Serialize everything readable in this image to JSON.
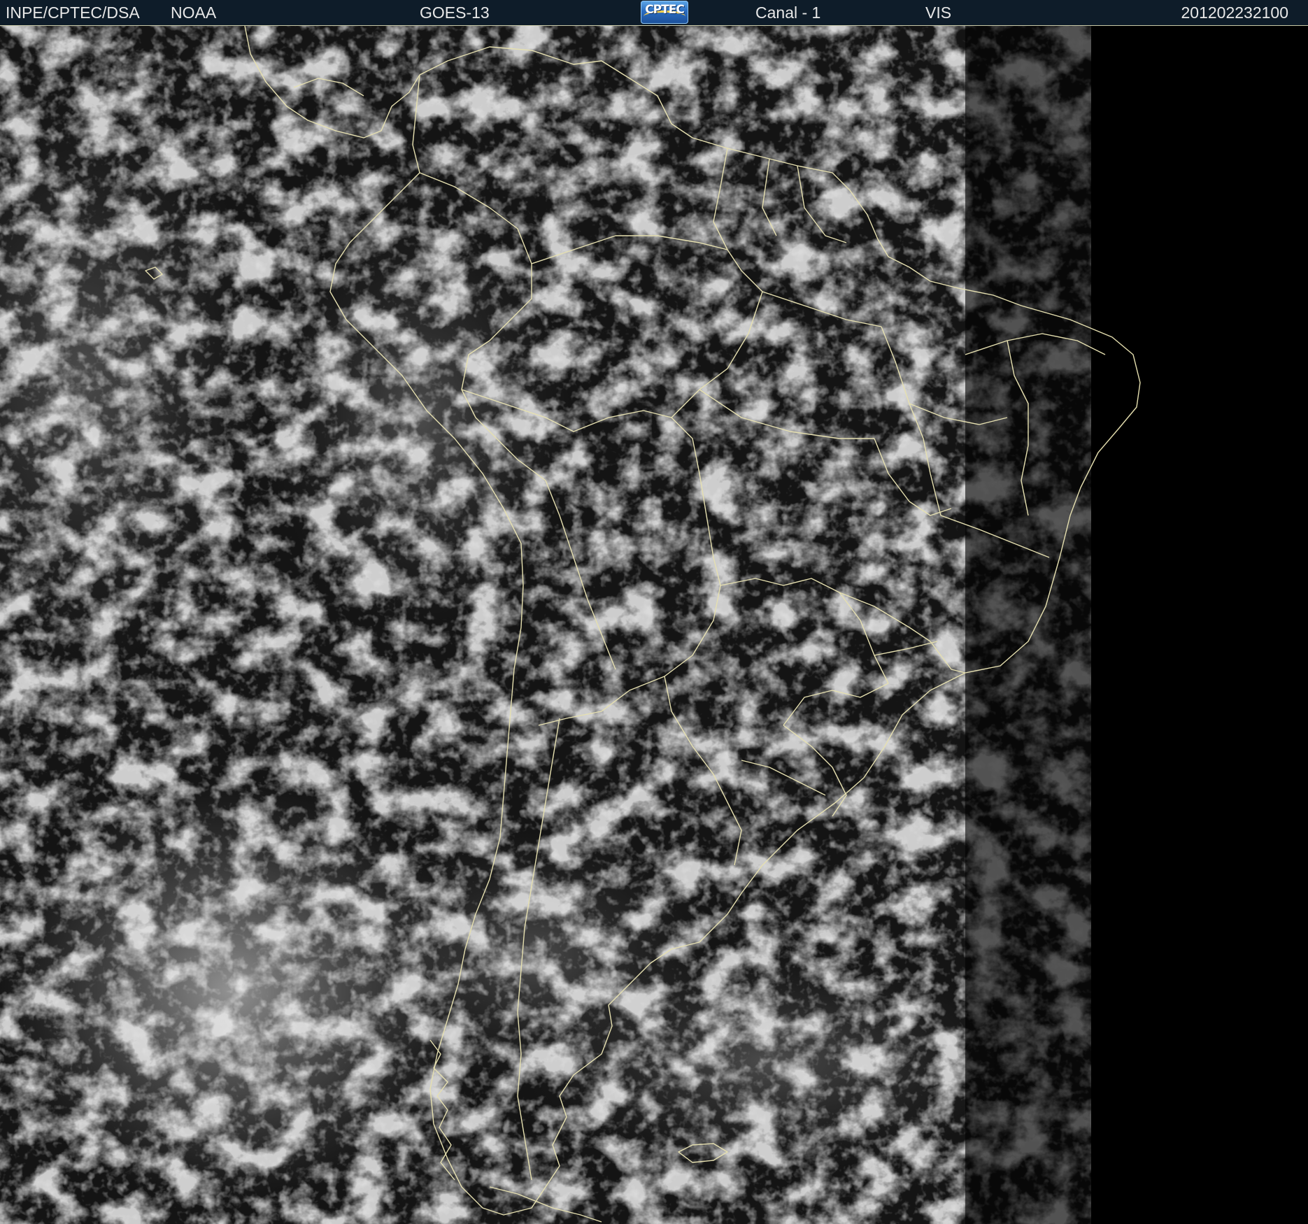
{
  "header": {
    "agency": "INPE/CPTEC/DSA",
    "partner": "NOAA",
    "satellite": "GOES-13",
    "logo_text": "CPTEC",
    "channel": "Canal - 1",
    "band": "VIS",
    "timestamp": "201202232100"
  },
  "colors": {
    "header_background": "#0e1c29",
    "header_text": "#e8e8e8",
    "border_lines": "#e6e0b0",
    "ocean": "#000000",
    "cloud": "#d9d9d9"
  },
  "icons": {
    "logo": "cptec-logo"
  }
}
